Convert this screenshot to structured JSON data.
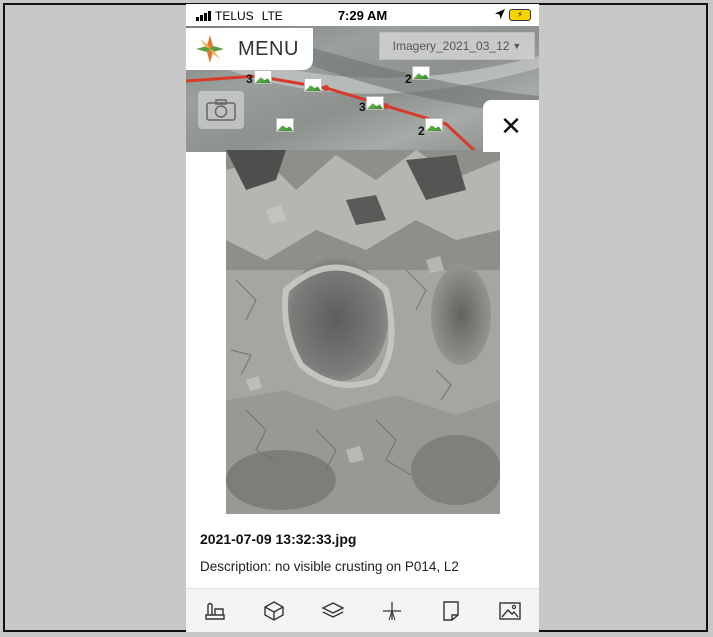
{
  "status_bar": {
    "carrier": "TELUS",
    "network": "LTE",
    "time": "7:29 AM"
  },
  "map": {
    "menu_label": "MENU",
    "imagery_layer": "Imagery_2021_03_12",
    "clusters": [
      {
        "count": "3"
      },
      {
        "count": "2"
      },
      {
        "count": "3"
      },
      {
        "count": "2"
      }
    ],
    "track_color": "#d83a2a"
  },
  "photo": {
    "filename": "2021-07-09 13:32:33.jpg",
    "description": "Description: no visible crusting on P014, L2"
  },
  "icons": {
    "close": "close-icon",
    "toolbar": [
      "terrain-tool-icon",
      "cube-icon",
      "layers-icon",
      "plus-icon",
      "note-icon",
      "image-icon"
    ]
  },
  "colors": {
    "accent_orange": "#e2792f",
    "accent_green": "#5a9b3f",
    "track_red": "#d83a2a"
  }
}
